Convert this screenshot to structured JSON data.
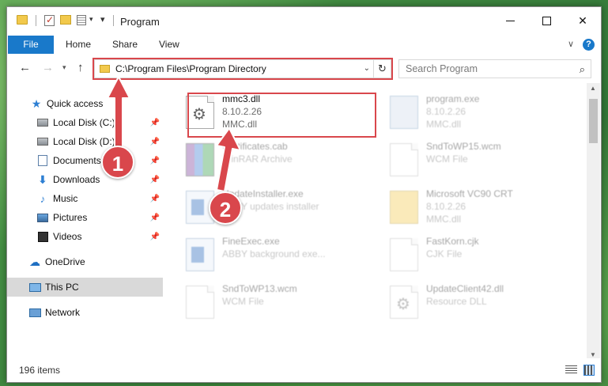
{
  "window": {
    "title": "Program",
    "qa_arrow": "▾"
  },
  "ribbon": {
    "tabs": [
      "File",
      "Home",
      "Share",
      "View"
    ],
    "help": "?"
  },
  "nav": {
    "address": "C:\\Program Files\\Program Directory",
    "search_placeholder": "Search Program"
  },
  "sidebar": {
    "items": [
      {
        "label": "Quick access",
        "icon": "star-icon",
        "pinned": false
      },
      {
        "label": "Local Disk (C:)",
        "icon": "disk-icon",
        "pinned": true
      },
      {
        "label": "Local Disk (D:)",
        "icon": "disk-icon",
        "pinned": true
      },
      {
        "label": "Documents",
        "icon": "documents-icon",
        "pinned": true
      },
      {
        "label": "Downloads",
        "icon": "download-icon",
        "pinned": true
      },
      {
        "label": "Music",
        "icon": "music-icon",
        "pinned": true
      },
      {
        "label": "Pictures",
        "icon": "pictures-icon",
        "pinned": true
      },
      {
        "label": "Videos",
        "icon": "videos-icon",
        "pinned": true
      },
      {
        "label": "OneDrive",
        "icon": "cloud-icon",
        "pinned": false
      },
      {
        "label": "This PC",
        "icon": "computer-icon",
        "pinned": false,
        "selected": true
      },
      {
        "label": "Network",
        "icon": "network-icon",
        "pinned": false
      }
    ]
  },
  "files": [
    {
      "name": "mmc3.dll",
      "line2": "8.10.2.26",
      "line3": "MMC.dll",
      "icon": "dll-gear-icon",
      "highlighted": true
    },
    {
      "name": "program.exe",
      "line2": "8.10.2.26",
      "line3": "MMC.dll",
      "icon": "program-exe-icon"
    },
    {
      "name": "Certificates.cab",
      "line2": "WinRAR Archive",
      "line3": "",
      "icon": "archive-icon"
    },
    {
      "name": "SndToWP15.wcm",
      "line2": "WCM File",
      "line3": "",
      "icon": "document-icon"
    },
    {
      "name": "UpdateInstaller.exe",
      "line2": "ABBY updates installer",
      "line3": "",
      "icon": "application-icon"
    },
    {
      "name": "Microsoft VC90 CRT",
      "line2": "8.10.2.26",
      "line3": "MMC.dll",
      "icon": "zip-folder-icon"
    },
    {
      "name": "FineExec.exe",
      "line2": "ABBY background exe...",
      "line3": "",
      "icon": "application-icon"
    },
    {
      "name": "FastKorn.cjk",
      "line2": "CJK File",
      "line3": "",
      "icon": "document-icon"
    },
    {
      "name": "SndToWP13.wcm",
      "line2": "WCM File",
      "line3": "",
      "icon": "document-icon"
    },
    {
      "name": "UpdateClient42.dll",
      "line2": "Resource DLL",
      "line3": "",
      "icon": "dll-gear-icon"
    }
  ],
  "status": {
    "items_count": "196 items"
  },
  "annotations": {
    "badge1": "1",
    "badge2": "2",
    "color": "#d9474c"
  }
}
